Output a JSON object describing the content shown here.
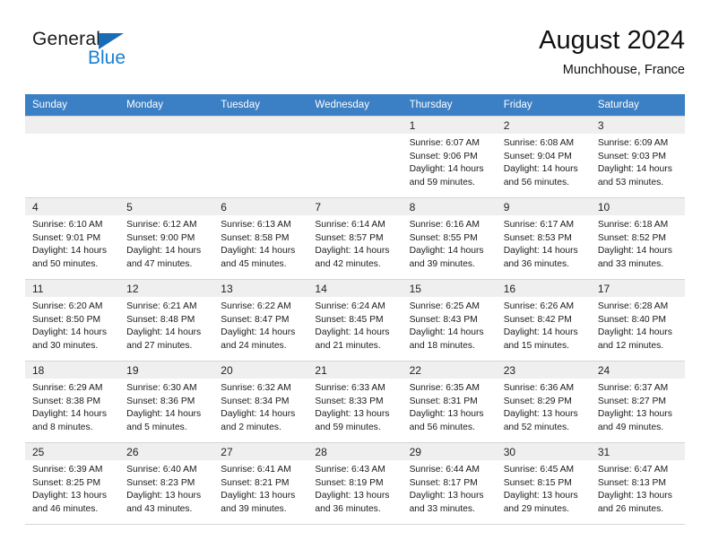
{
  "brand": {
    "line1": "General",
    "line2": "Blue",
    "triangle_color": "#1a6cb5",
    "blue_text_color": "#1a7fd4"
  },
  "header": {
    "title": "August 2024",
    "location": "Munchhouse, France"
  },
  "theme": {
    "header_row_bg": "#3b7fc4",
    "daynum_bg": "#efefef",
    "grid_line": "#d5d5d5"
  },
  "weekday_headers": [
    "Sunday",
    "Monday",
    "Tuesday",
    "Wednesday",
    "Thursday",
    "Friday",
    "Saturday"
  ],
  "weeks": [
    [
      {
        "day": "",
        "sunrise": "",
        "sunset": "",
        "daylight_1": "",
        "daylight_2": "",
        "empty": true
      },
      {
        "day": "",
        "sunrise": "",
        "sunset": "",
        "daylight_1": "",
        "daylight_2": "",
        "empty": true
      },
      {
        "day": "",
        "sunrise": "",
        "sunset": "",
        "daylight_1": "",
        "daylight_2": "",
        "empty": true
      },
      {
        "day": "",
        "sunrise": "",
        "sunset": "",
        "daylight_1": "",
        "daylight_2": "",
        "empty": true
      },
      {
        "day": "1",
        "sunrise": "Sunrise: 6:07 AM",
        "sunset": "Sunset: 9:06 PM",
        "daylight_1": "Daylight: 14 hours",
        "daylight_2": "and 59 minutes."
      },
      {
        "day": "2",
        "sunrise": "Sunrise: 6:08 AM",
        "sunset": "Sunset: 9:04 PM",
        "daylight_1": "Daylight: 14 hours",
        "daylight_2": "and 56 minutes."
      },
      {
        "day": "3",
        "sunrise": "Sunrise: 6:09 AM",
        "sunset": "Sunset: 9:03 PM",
        "daylight_1": "Daylight: 14 hours",
        "daylight_2": "and 53 minutes."
      }
    ],
    [
      {
        "day": "4",
        "sunrise": "Sunrise: 6:10 AM",
        "sunset": "Sunset: 9:01 PM",
        "daylight_1": "Daylight: 14 hours",
        "daylight_2": "and 50 minutes."
      },
      {
        "day": "5",
        "sunrise": "Sunrise: 6:12 AM",
        "sunset": "Sunset: 9:00 PM",
        "daylight_1": "Daylight: 14 hours",
        "daylight_2": "and 47 minutes."
      },
      {
        "day": "6",
        "sunrise": "Sunrise: 6:13 AM",
        "sunset": "Sunset: 8:58 PM",
        "daylight_1": "Daylight: 14 hours",
        "daylight_2": "and 45 minutes."
      },
      {
        "day": "7",
        "sunrise": "Sunrise: 6:14 AM",
        "sunset": "Sunset: 8:57 PM",
        "daylight_1": "Daylight: 14 hours",
        "daylight_2": "and 42 minutes."
      },
      {
        "day": "8",
        "sunrise": "Sunrise: 6:16 AM",
        "sunset": "Sunset: 8:55 PM",
        "daylight_1": "Daylight: 14 hours",
        "daylight_2": "and 39 minutes."
      },
      {
        "day": "9",
        "sunrise": "Sunrise: 6:17 AM",
        "sunset": "Sunset: 8:53 PM",
        "daylight_1": "Daylight: 14 hours",
        "daylight_2": "and 36 minutes."
      },
      {
        "day": "10",
        "sunrise": "Sunrise: 6:18 AM",
        "sunset": "Sunset: 8:52 PM",
        "daylight_1": "Daylight: 14 hours",
        "daylight_2": "and 33 minutes."
      }
    ],
    [
      {
        "day": "11",
        "sunrise": "Sunrise: 6:20 AM",
        "sunset": "Sunset: 8:50 PM",
        "daylight_1": "Daylight: 14 hours",
        "daylight_2": "and 30 minutes."
      },
      {
        "day": "12",
        "sunrise": "Sunrise: 6:21 AM",
        "sunset": "Sunset: 8:48 PM",
        "daylight_1": "Daylight: 14 hours",
        "daylight_2": "and 27 minutes."
      },
      {
        "day": "13",
        "sunrise": "Sunrise: 6:22 AM",
        "sunset": "Sunset: 8:47 PM",
        "daylight_1": "Daylight: 14 hours",
        "daylight_2": "and 24 minutes."
      },
      {
        "day": "14",
        "sunrise": "Sunrise: 6:24 AM",
        "sunset": "Sunset: 8:45 PM",
        "daylight_1": "Daylight: 14 hours",
        "daylight_2": "and 21 minutes."
      },
      {
        "day": "15",
        "sunrise": "Sunrise: 6:25 AM",
        "sunset": "Sunset: 8:43 PM",
        "daylight_1": "Daylight: 14 hours",
        "daylight_2": "and 18 minutes."
      },
      {
        "day": "16",
        "sunrise": "Sunrise: 6:26 AM",
        "sunset": "Sunset: 8:42 PM",
        "daylight_1": "Daylight: 14 hours",
        "daylight_2": "and 15 minutes."
      },
      {
        "day": "17",
        "sunrise": "Sunrise: 6:28 AM",
        "sunset": "Sunset: 8:40 PM",
        "daylight_1": "Daylight: 14 hours",
        "daylight_2": "and 12 minutes."
      }
    ],
    [
      {
        "day": "18",
        "sunrise": "Sunrise: 6:29 AM",
        "sunset": "Sunset: 8:38 PM",
        "daylight_1": "Daylight: 14 hours",
        "daylight_2": "and 8 minutes."
      },
      {
        "day": "19",
        "sunrise": "Sunrise: 6:30 AM",
        "sunset": "Sunset: 8:36 PM",
        "daylight_1": "Daylight: 14 hours",
        "daylight_2": "and 5 minutes."
      },
      {
        "day": "20",
        "sunrise": "Sunrise: 6:32 AM",
        "sunset": "Sunset: 8:34 PM",
        "daylight_1": "Daylight: 14 hours",
        "daylight_2": "and 2 minutes."
      },
      {
        "day": "21",
        "sunrise": "Sunrise: 6:33 AM",
        "sunset": "Sunset: 8:33 PM",
        "daylight_1": "Daylight: 13 hours",
        "daylight_2": "and 59 minutes."
      },
      {
        "day": "22",
        "sunrise": "Sunrise: 6:35 AM",
        "sunset": "Sunset: 8:31 PM",
        "daylight_1": "Daylight: 13 hours",
        "daylight_2": "and 56 minutes."
      },
      {
        "day": "23",
        "sunrise": "Sunrise: 6:36 AM",
        "sunset": "Sunset: 8:29 PM",
        "daylight_1": "Daylight: 13 hours",
        "daylight_2": "and 52 minutes."
      },
      {
        "day": "24",
        "sunrise": "Sunrise: 6:37 AM",
        "sunset": "Sunset: 8:27 PM",
        "daylight_1": "Daylight: 13 hours",
        "daylight_2": "and 49 minutes."
      }
    ],
    [
      {
        "day": "25",
        "sunrise": "Sunrise: 6:39 AM",
        "sunset": "Sunset: 8:25 PM",
        "daylight_1": "Daylight: 13 hours",
        "daylight_2": "and 46 minutes."
      },
      {
        "day": "26",
        "sunrise": "Sunrise: 6:40 AM",
        "sunset": "Sunset: 8:23 PM",
        "daylight_1": "Daylight: 13 hours",
        "daylight_2": "and 43 minutes."
      },
      {
        "day": "27",
        "sunrise": "Sunrise: 6:41 AM",
        "sunset": "Sunset: 8:21 PM",
        "daylight_1": "Daylight: 13 hours",
        "daylight_2": "and 39 minutes."
      },
      {
        "day": "28",
        "sunrise": "Sunrise: 6:43 AM",
        "sunset": "Sunset: 8:19 PM",
        "daylight_1": "Daylight: 13 hours",
        "daylight_2": "and 36 minutes."
      },
      {
        "day": "29",
        "sunrise": "Sunrise: 6:44 AM",
        "sunset": "Sunset: 8:17 PM",
        "daylight_1": "Daylight: 13 hours",
        "daylight_2": "and 33 minutes."
      },
      {
        "day": "30",
        "sunrise": "Sunrise: 6:45 AM",
        "sunset": "Sunset: 8:15 PM",
        "daylight_1": "Daylight: 13 hours",
        "daylight_2": "and 29 minutes."
      },
      {
        "day": "31",
        "sunrise": "Sunrise: 6:47 AM",
        "sunset": "Sunset: 8:13 PM",
        "daylight_1": "Daylight: 13 hours",
        "daylight_2": "and 26 minutes."
      }
    ]
  ]
}
